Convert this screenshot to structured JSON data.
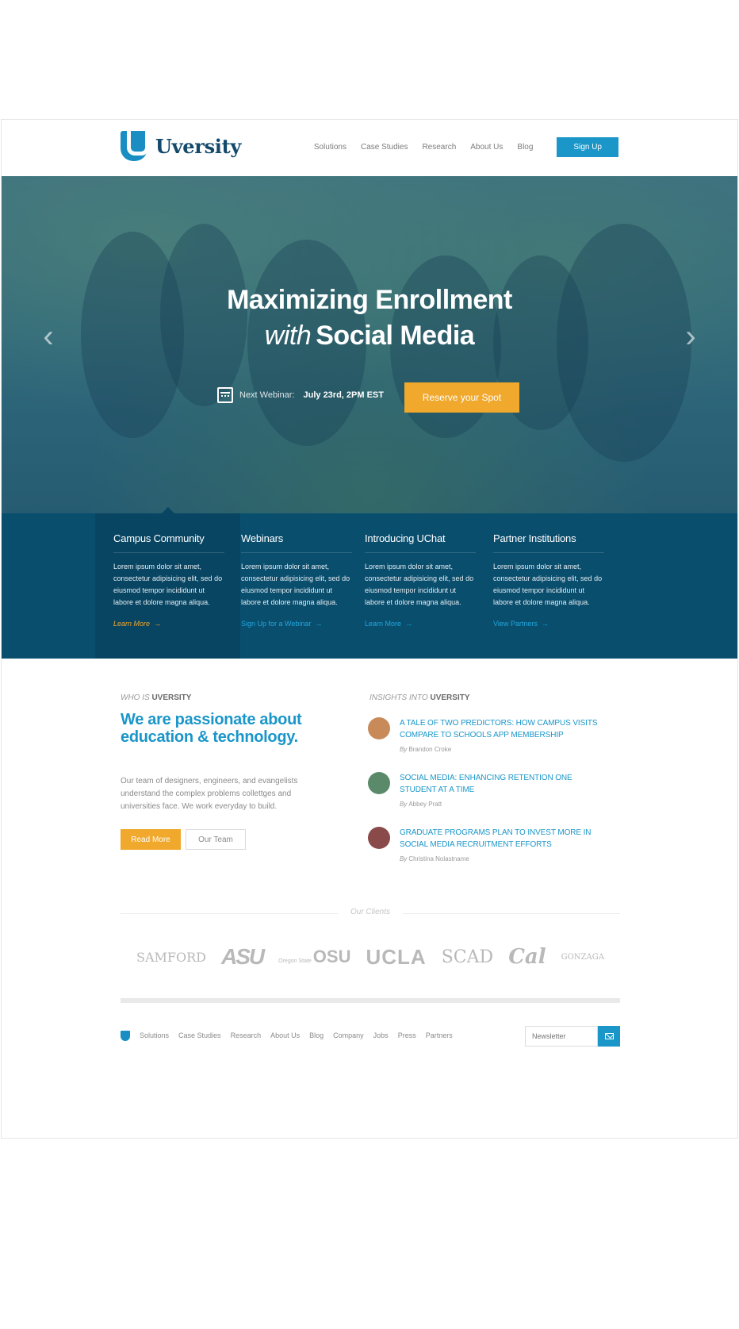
{
  "header": {
    "brand": "Uversity",
    "nav": [
      "Solutions",
      "Case Studies",
      "Research",
      "About Us",
      "Blog"
    ],
    "signup_label": "Sign Up"
  },
  "hero": {
    "title_line1": "Maximizing Enrollment",
    "title_line2_italic": "with",
    "title_line2_bold": "Social Media",
    "webinar_label": "Next Webinar:",
    "webinar_date": "July 23rd, 2PM EST",
    "cta_label": "Reserve your Spot",
    "prev_icon": "chevron-left-icon",
    "next_icon": "chevron-right-icon"
  },
  "features": [
    {
      "title": "Campus Community",
      "text": "Lorem ipsum dolor sit amet, consectetur adipisicing elit, sed do eiusmod tempor incididunt ut labore et dolore magna aliqua.",
      "link": "Learn More",
      "active": true
    },
    {
      "title": "Webinars",
      "text": "Lorem ipsum dolor sit amet, consectetur adipisicing elit, sed do eiusmod tempor incididunt ut labore et dolore magna aliqua.",
      "link": "Sign Up for a Webinar",
      "active": false
    },
    {
      "title": "Introducing UChat",
      "text": "Lorem ipsum dolor sit amet, consectetur adipisicing elit, sed do eiusmod tempor incididunt ut labore et dolore magna aliqua.",
      "link": "Learn More",
      "active": false
    },
    {
      "title": "Partner Institutions",
      "text": "Lorem ipsum dolor sit amet, consectetur adipisicing elit, sed do eiusmod tempor incididunt ut labore et dolore magna aliqua.",
      "link": "View Partners",
      "active": false
    }
  ],
  "about": {
    "kicker_light": "WHO IS",
    "kicker_bold": "UVERSITY",
    "title": "We are passionate about education & technology.",
    "text": "Our team of designers, engineers, and evangelists understand the complex problems collettges and universities face. We work everyday to build.",
    "read_more": "Read More",
    "our_team": "Our Team"
  },
  "insights": {
    "kicker_light": "INSIGHTS INTO",
    "kicker_bold": "UVERSITY",
    "by_label": "By",
    "items": [
      {
        "title": "A Tale of Two Predictors: How Campus Visits Compare to Schools App Membership",
        "author": "Brandon Croke",
        "avatar_color": "#c98a5a"
      },
      {
        "title": "Social Media: Enhancing Retention One Student at a Time",
        "author": "Abbey Pratt",
        "avatar_color": "#5a8a6a"
      },
      {
        "title": "Graduate Programs Plan to Invest More in Social Media Recruitment Efforts",
        "author": "Christina Nolastname",
        "avatar_color": "#8a4a4a"
      }
    ]
  },
  "clients": {
    "label": "Our Clients",
    "logos": [
      "SAMFORD",
      "ASU",
      "Oregon State",
      "OSU",
      "UCLA",
      "SCAD",
      "Cal",
      "GONZAGA"
    ]
  },
  "footer": {
    "links": [
      "Solutions",
      "Case Studies",
      "Research",
      "About Us",
      "Blog",
      "Company",
      "Jobs",
      "Press",
      "Partners"
    ],
    "newsletter_placeholder": "Newsletter"
  },
  "colors": {
    "brand_blue": "#1a96c9",
    "navy": "#0a4e6e",
    "accent_orange": "#f0a82d"
  }
}
